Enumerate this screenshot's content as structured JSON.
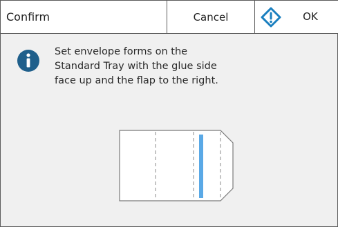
{
  "dialog": {
    "title": "Confirm",
    "cancel_label": "Cancel",
    "ok_label": "OK",
    "ok_icon": "diamond-ok-icon",
    "info_icon": "info-icon",
    "message_lines": [
      "Set envelope forms on the",
      "Standard Tray with the glue side",
      "face up and the flap to the right."
    ]
  },
  "colors": {
    "accent": "#1a7fbf",
    "info_circle": "#1f5f8b",
    "glue_strip": "#5aa9e6",
    "border": "#5a5a5a",
    "background": "#f0f0f0"
  }
}
